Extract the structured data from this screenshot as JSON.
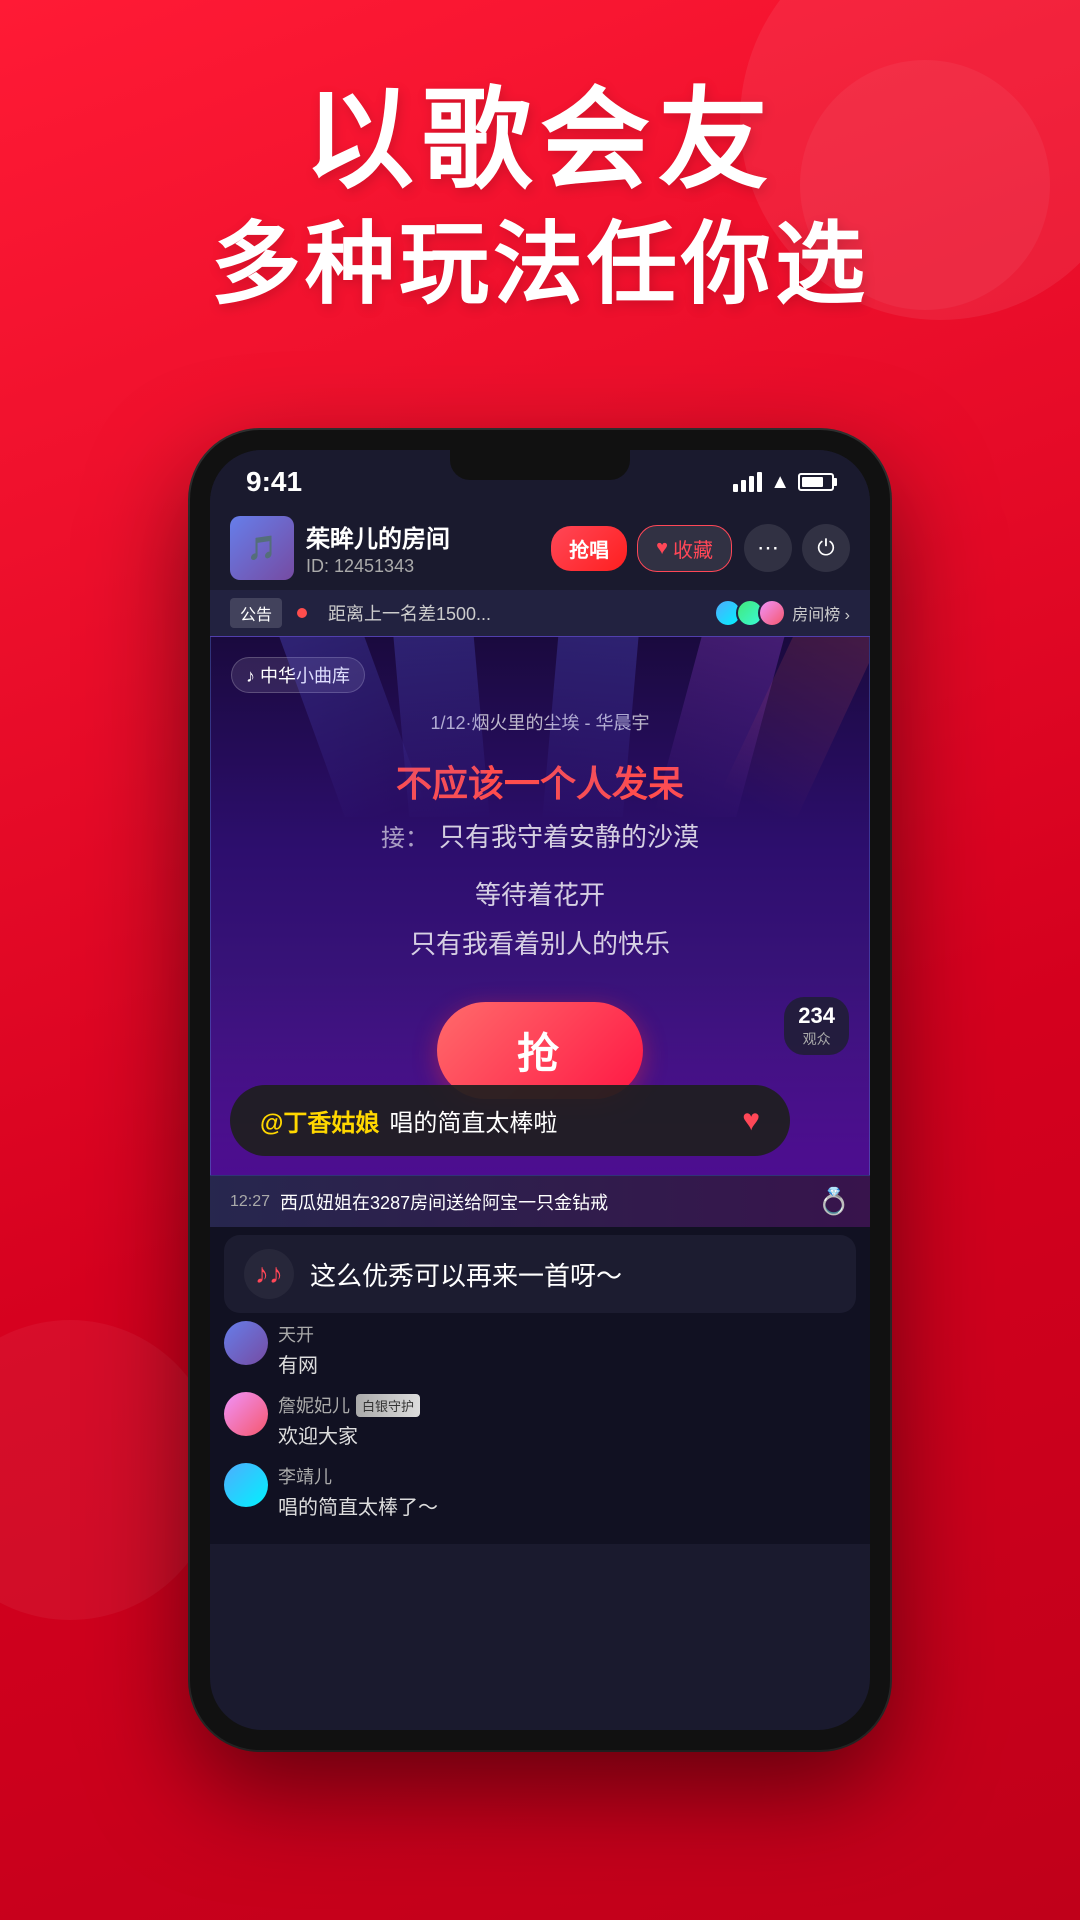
{
  "app": {
    "background_color": "#e8192c"
  },
  "hero": {
    "line1": "以歌会友",
    "line2": "多种玩法任你选"
  },
  "phone": {
    "status_bar": {
      "time": "9:41"
    },
    "room_header": {
      "room_name": "茱眸儿的房间",
      "room_id": "ID: 12451343",
      "btn_qiang": "抢唱",
      "btn_collect": "♥ 收藏"
    },
    "announce": {
      "label": "公告",
      "dot": true,
      "text": "距离上一名差1500...",
      "rank_label": "房间榜 ›"
    },
    "karaoke": {
      "library_tag": "♪ 中华小曲库",
      "song_info": "1/12·烟火里的尘埃 - 华晨宇",
      "lyrics_current": "不应该一个人发呆",
      "next_label": "接：",
      "lyrics_next_1": "只有我守着安静的沙漠",
      "lyrics_next_2": "等待着花开",
      "lyrics_next_3": "只有我看着别人的快乐",
      "grab_btn": "抢"
    },
    "comment_toast": {
      "at_user": "@丁香姑娘",
      "text": "唱的简直太棒啦"
    },
    "gift_notify": {
      "time": "12:27",
      "text": "西瓜妞姐在3287房间送给阿宝一只金钻戒"
    },
    "music_toast": {
      "text": "这么优秀可以再来一首呀～"
    },
    "audience": {
      "count": "234",
      "label": "观众"
    },
    "chat_messages": [
      {
        "username": "天开",
        "badge": "",
        "message": "有网",
        "avatar_class": "chat-av1"
      },
      {
        "username": "詹妮妃儿",
        "badge": "白银守护",
        "message": "欢迎大家",
        "avatar_class": "chat-av2"
      },
      {
        "username": "李靖儿",
        "badge": "",
        "message": "唱的简直太棒了～",
        "avatar_class": "chat-av3"
      }
    ]
  }
}
